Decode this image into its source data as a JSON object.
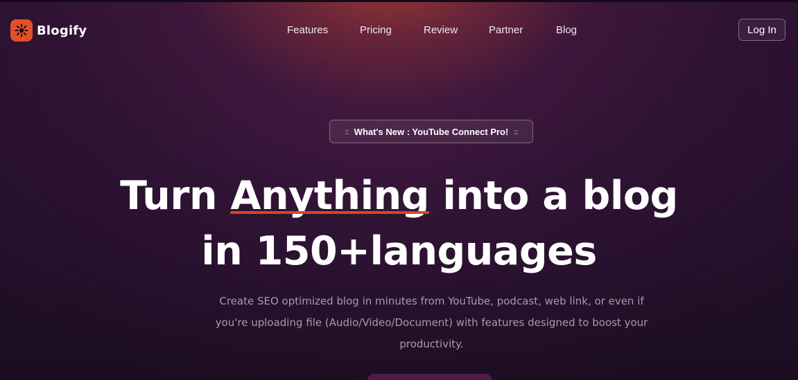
{
  "brand": {
    "name": "Blogify",
    "logo_icon": "sun-burst-icon",
    "accent_color": "#e0502a"
  },
  "nav": {
    "items": [
      {
        "label": "Features"
      },
      {
        "label": "Pricing"
      },
      {
        "label": "Review"
      },
      {
        "label": "Partner"
      },
      {
        "label": "Blog"
      }
    ],
    "login_label": "Log In"
  },
  "hero": {
    "badge": {
      "dots_left": "::",
      "text": "What's New : YouTube Connect Pro!",
      "dots_right": "::"
    },
    "headline": {
      "line1_before": "Turn ",
      "line1_highlight": "Anything",
      "line1_after": " into a blog",
      "line2": "in 150+languages"
    },
    "subtitle": "Create SEO optimized blog in minutes from YouTube, podcast, web link, or even if you're uploading file (Audio/Video/Document) with features designed to boost your productivity.",
    "underline_color": "#d9461e"
  }
}
